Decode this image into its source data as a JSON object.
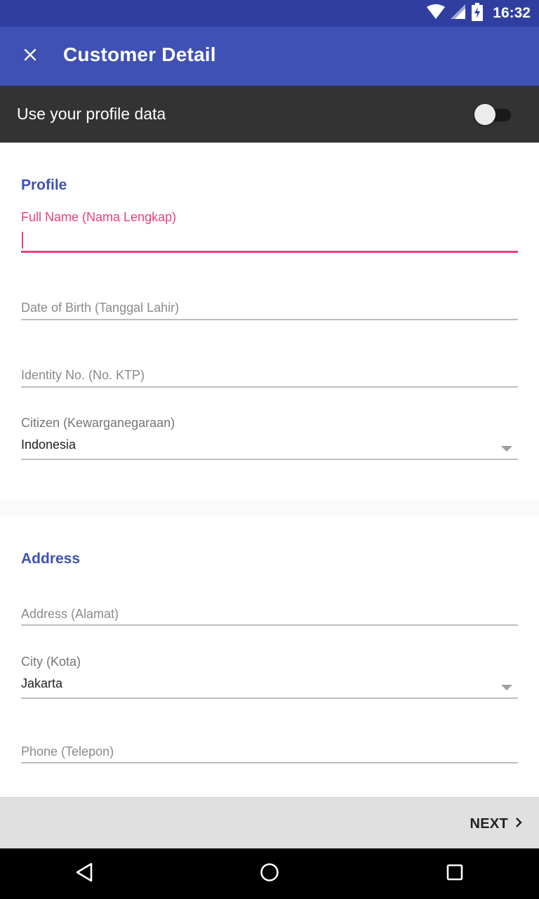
{
  "status_bar": {
    "time": "16:32",
    "icons": [
      "wifi-icon",
      "signal-icon",
      "battery-charging-icon"
    ]
  },
  "app_bar": {
    "close_icon": "close-icon",
    "title": "Customer Detail"
  },
  "profile_toggle": {
    "label": "Use your profile data",
    "enabled": false
  },
  "profile_section": {
    "title": "Profile",
    "full_name": {
      "label": "Full Name (Nama Lengkap)",
      "value": ""
    },
    "dob": {
      "placeholder": "Date of Birth (Tanggal Lahir)"
    },
    "identity": {
      "placeholder": "Identity No. (No. KTP)"
    },
    "citizen": {
      "label": "Citizen (Kewarganegaraan)",
      "value": "Indonesia"
    }
  },
  "address_section": {
    "title": "Address",
    "address": {
      "placeholder": "Address (Alamat)"
    },
    "city": {
      "label": "City (Kota)",
      "value": "Jakarta"
    },
    "phone": {
      "placeholder": "Phone (Telepon)"
    }
  },
  "footer": {
    "next_label": "NEXT",
    "next_icon": "chevron-right-icon"
  },
  "nav_bar": {
    "buttons": [
      "back-icon",
      "home-icon",
      "recents-icon"
    ]
  },
  "colors": {
    "primary": "#3f51b5",
    "primary_dark": "#303f9f",
    "accent": "#ec407a",
    "toggle_bar": "#333333"
  }
}
